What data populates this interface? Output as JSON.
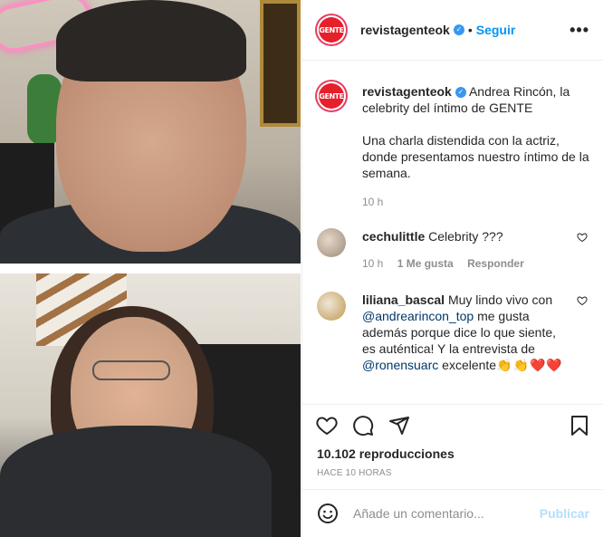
{
  "header": {
    "username": "revistagenteok",
    "verified_mark": "✓",
    "separator": "•",
    "follow_label": "Seguir",
    "more_label": "•••",
    "logo_text": "GENTE"
  },
  "caption": {
    "username": "revistagenteok",
    "title": " Andrea Rincón, la celebrity del íntimo de GENTE",
    "body": "Una charla distendida con la actriz, donde presentamos nuestro íntimo de la semana.",
    "time": "10 h"
  },
  "comments": [
    {
      "username": "cechulittle",
      "text": " Celebrity ???",
      "time": "10 h",
      "likes": "1 Me gusta",
      "reply": "Responder"
    },
    {
      "username": "liliana_bascal",
      "text_a": " Muy lindo vivo con ",
      "mention1": "@andrearincon_top",
      "text_b": " me gusta además porque dice lo que siente, es auténtica! Y la entrevista de ",
      "mention2": "@ronensuarc",
      "text_c": " excelente",
      "emojis": "👏👏❤️❤️"
    }
  ],
  "actions": {
    "views": "10.102 reproducciones",
    "ago": "HACE 10 HORAS"
  },
  "add_comment": {
    "placeholder": "Añade un comentario...",
    "publish_label": "Publicar"
  },
  "colors": {
    "follow": "#0095f6",
    "verified": "#3897f0",
    "publish_disabled": "#b2dffc",
    "brand_red": "#e5202b"
  }
}
